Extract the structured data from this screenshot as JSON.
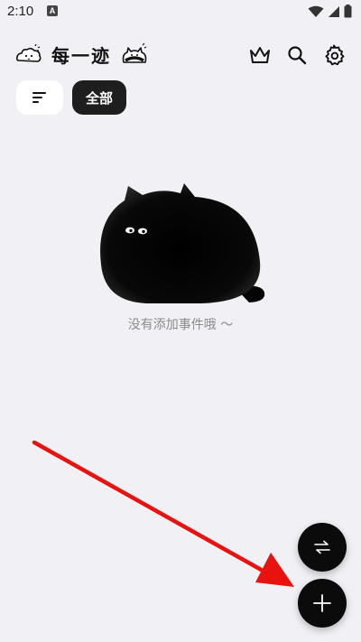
{
  "status_bar": {
    "time": "2:10",
    "notification_badge": "A"
  },
  "header": {
    "title": "每一迹",
    "icons": [
      "premium-crown-icon",
      "search-icon",
      "settings-gear-icon"
    ]
  },
  "filters": {
    "sort_icon": "sort-lines-icon",
    "chip_all_label": "全部"
  },
  "empty_state": {
    "message": "没有添加事件哦 ～"
  },
  "fabs": {
    "switch_icon": "swap-arrows-icon",
    "add_icon": "plus-icon"
  },
  "annotation": {
    "arrow_color": "#e8130f"
  },
  "colors": {
    "background": "#f1f0f5",
    "chip_active": "#1e1e1e",
    "fab": "#0b0b0b"
  }
}
